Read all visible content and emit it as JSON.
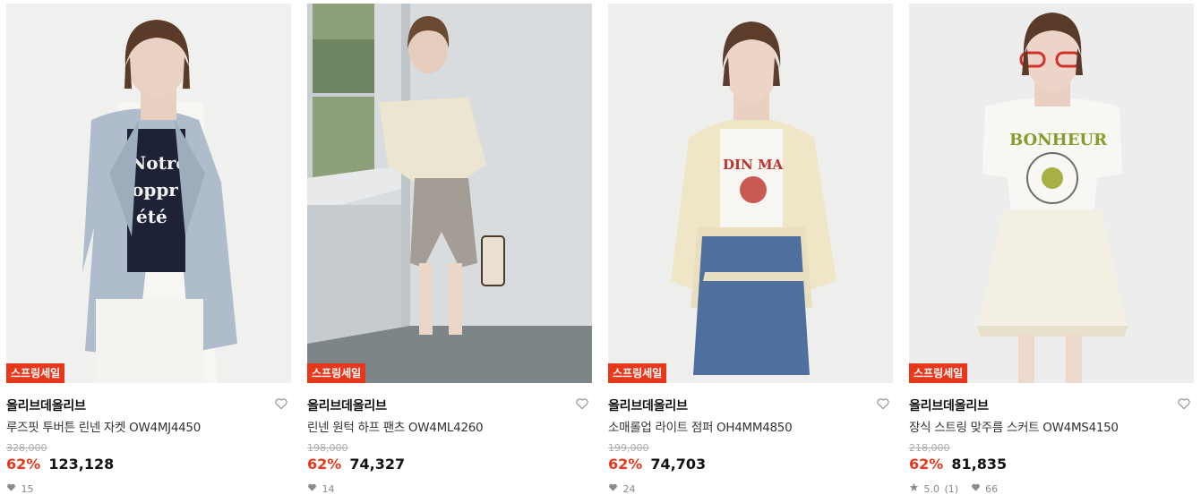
{
  "colors": {
    "sale": "#e8381b",
    "heart_meta": "#8c8c8c",
    "text": "#111111"
  },
  "products": [
    {
      "badge": "스프링세일",
      "brand": "올리브데올리브",
      "name": "루즈핏 투버튼 린넨 자켓 OW4MJ4450",
      "original_price": "328,000",
      "discount": "62%",
      "price": "123,128",
      "rating": null,
      "reviews": null,
      "likes": "15",
      "image": "model-light-blue-linen-jacket"
    },
    {
      "badge": "스프링세일",
      "brand": "올리브데올리브",
      "name": "린넨 원턱 하프 팬츠 OW4ML4260",
      "original_price": "198,000",
      "discount": "62%",
      "price": "74,327",
      "rating": null,
      "reviews": null,
      "likes": "14",
      "image": "model-linen-half-pants-window"
    },
    {
      "badge": "스프링세일",
      "brand": "올리브데올리브",
      "name": "소매롤업 라이트 점퍼 OH4MM4850",
      "original_price": "199,000",
      "discount": "62%",
      "price": "74,703",
      "rating": null,
      "reviews": null,
      "likes": "24",
      "image": "model-cream-light-jumper"
    },
    {
      "badge": "스프링세일",
      "brand": "올리브데올리브",
      "name": "장식 스트링 맞주름 스커트 OW4MS4150",
      "original_price": "218,000",
      "discount": "62%",
      "price": "81,835",
      "rating": "5.0",
      "reviews": "(1)",
      "likes": "66",
      "image": "model-cream-pleated-skirt"
    }
  ]
}
